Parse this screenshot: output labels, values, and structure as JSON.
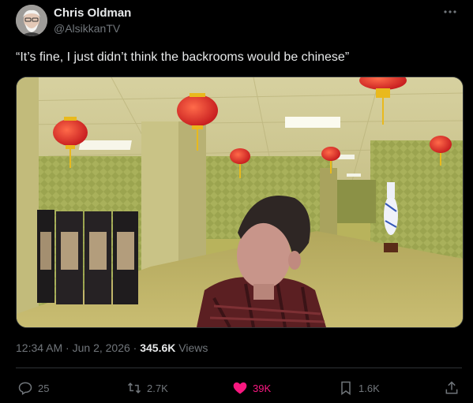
{
  "author": {
    "name": "Chris Oldman",
    "handle": "@AlsikkanTV",
    "avatar_icon": "avatar-photo"
  },
  "more_icon": "more-horizontal-icon",
  "tweet": {
    "text": "“It’s fine, I just didn’t think the backrooms would be chinese”"
  },
  "media": {
    "description_icons": [
      "red-lantern",
      "folding-screen",
      "blue-white-vase",
      "person"
    ]
  },
  "meta": {
    "time": "12:34 AM",
    "sep1": "·",
    "date": "Jun 2, 2026",
    "sep2": "·",
    "views_count": "345.6K",
    "views_label": "Views"
  },
  "actions": {
    "reply": {
      "icon": "reply-icon",
      "count": "25"
    },
    "repost": {
      "icon": "repost-icon",
      "count": "2.7K"
    },
    "like": {
      "icon": "heart-icon",
      "count": "39K",
      "color": "#f91880"
    },
    "bookmark": {
      "icon": "bookmark-icon",
      "count": "1.6K"
    },
    "share": {
      "icon": "share-icon"
    }
  },
  "colors": {
    "background": "#000000",
    "text": "#e7e9ea",
    "muted": "#71767b",
    "like": "#f91880"
  }
}
